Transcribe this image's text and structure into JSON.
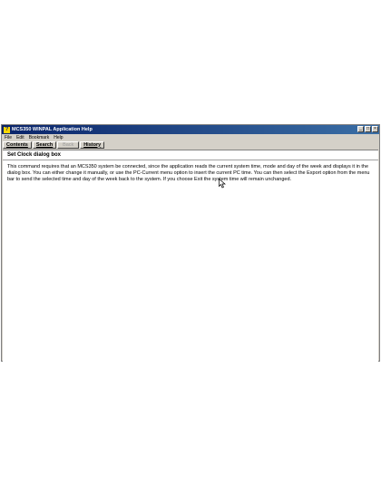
{
  "window": {
    "title": "MCS350 WINPAL Application Help",
    "title_icon": "?",
    "controls": {
      "minimize": "_",
      "maximize": "□",
      "close": "×"
    }
  },
  "menu": {
    "file": "File",
    "edit": "Edit",
    "bookmark": "Bookmark",
    "help": "Help"
  },
  "toolbar": {
    "contents": "Contents",
    "search": "Search",
    "back": "Back",
    "history": "History"
  },
  "topic": {
    "heading": "Set Clock dialog box",
    "body": "This command requires that an MCS350 system be connected, since the application reads the current system time, mode and day of the week and displays it in the dialog box. You can either change it manually, or use the PC-Current menu option to insert the current PC time. You can then select the Export option from the menu bar to send the selected time and day of the week back to the system. If you choose Exit the system time will remain unchanged."
  },
  "icons": {
    "app": "help-book-icon",
    "cursor": "arrow-pointer-icon"
  },
  "colors": {
    "titlebar_start": "#0a246a",
    "titlebar_end": "#3a6ea5",
    "chrome": "#d4d0c8"
  }
}
